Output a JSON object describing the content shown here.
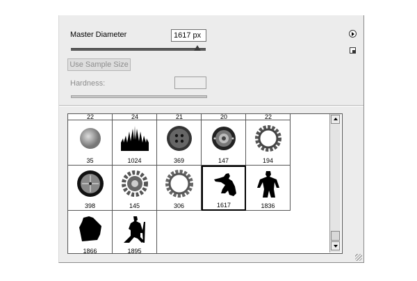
{
  "controls": {
    "master_diameter_label": "Master Diameter",
    "master_diameter_value": "1617 px",
    "master_diameter_level": 0.94,
    "use_sample_size_label": "Use Sample Size",
    "hardness_label": "Hardness:",
    "hardness_value": ""
  },
  "icons": {
    "panel_menu": "flyout-arrow-icon",
    "resize": "resize-grip-icon",
    "view_toggle": "small-thumbnail-icon"
  },
  "brush_grid": {
    "partial_row_labels": [
      "22",
      "24",
      "21",
      "20",
      "22"
    ],
    "brushes": [
      {
        "size": "35",
        "icon": "soft-round-brush-icon"
      },
      {
        "size": "1024",
        "icon": "cathedral-silhouette-brush-icon"
      },
      {
        "size": "369",
        "icon": "button-brush-icon"
      },
      {
        "size": "147",
        "icon": "doorbell-brush-icon"
      },
      {
        "size": "194",
        "icon": "gear-ring-brush-icon"
      },
      {
        "size": "398",
        "icon": "compass-brush-icon"
      },
      {
        "size": "145",
        "icon": "gear-brush-icon"
      },
      {
        "size": "306",
        "icon": "gear-ring-brush-icon"
      },
      {
        "size": "1617",
        "icon": "crouching-figure-brush-icon",
        "selected": true
      },
      {
        "size": "1836",
        "icon": "standing-figure-brush-icon"
      },
      {
        "size": "1866",
        "icon": "hunched-figure-brush-icon"
      },
      {
        "size": "1895",
        "icon": "walking-man-brush-icon"
      }
    ]
  }
}
